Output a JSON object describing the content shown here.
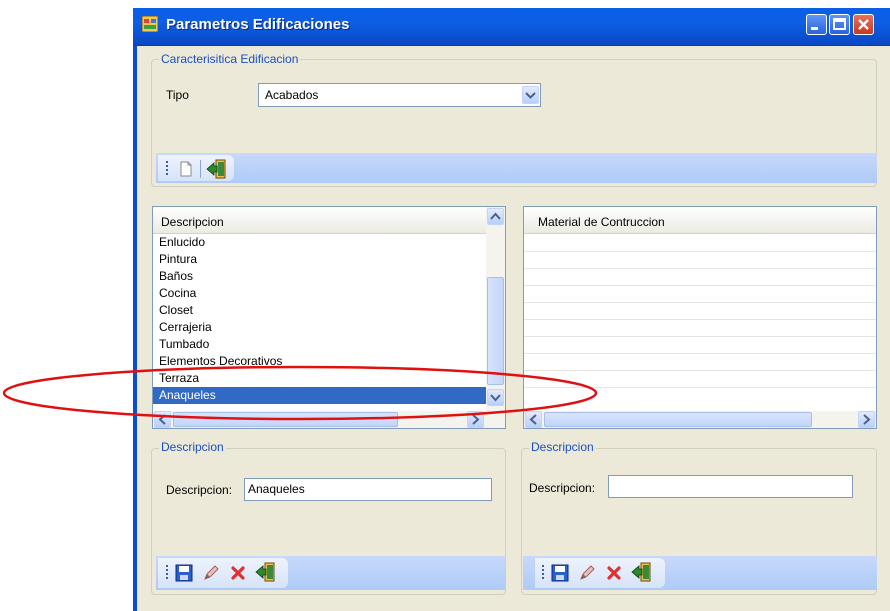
{
  "window": {
    "title": "Parametros Edificaciones"
  },
  "characteristic_group": {
    "title": "Caracterisitica Edificacion",
    "tipo_label": "Tipo",
    "tipo_value": "Acabados"
  },
  "left_list": {
    "header": "Descripcion",
    "items": [
      "Enlucido",
      "Pintura",
      "Baños",
      "Cocina",
      "Closet",
      "Cerrajeria",
      "Tumbado",
      "Elementos Decorativos",
      "Terraza",
      "Anaqueles"
    ],
    "selected_index": 9
  },
  "right_list": {
    "header": "Material de Contruccion"
  },
  "left_detail": {
    "title": "Descripcion",
    "field_label": "Descripcion:",
    "field_value": "Anaqueles"
  },
  "right_detail": {
    "title": "Descripcion",
    "field_label": "Descripcion:",
    "field_value": ""
  },
  "icons": [
    "app-icon",
    "minimize-icon",
    "maximize-icon",
    "close-icon",
    "new-document-icon",
    "exit-icon",
    "save-icon",
    "edit-pencil-icon",
    "delete-x-icon",
    "dropdown-arrow-icon"
  ],
  "colors": {
    "title_bar": "#0a5ee8",
    "selection": "#316ac5",
    "group_label": "#1a4fc4",
    "annotation_ellipse": "#e01010",
    "toolstrip": "#c7d9fb"
  }
}
